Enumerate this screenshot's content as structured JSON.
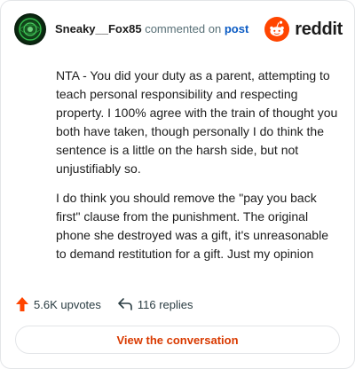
{
  "comment": {
    "username": "Sneaky__Fox85",
    "commented_on": "commented on",
    "post_link": "post",
    "brand": "reddit",
    "paragraphs": [
      "NTA - You did your duty as a parent, attempting to teach personal responsibility and respecting property. I 100% agree with the train of thought you both have taken, though personally I do think the sentence is a little on the harsh side, but not unjustifiably so.",
      "I do think you should remove the \"pay you back first\" clause from the punishment. The original phone she destroyed was a gift, it's unreasonable to demand restitution for a gift. Just my opinion"
    ]
  },
  "actions": {
    "upvotes": "5.6K upvotes",
    "replies": "116 replies"
  },
  "cta": {
    "label": "View the conversation"
  },
  "colors": {
    "accent": "#d93a00",
    "upvote": "#ff4500",
    "link": "#0a5bc4",
    "reddit_orange": "#ff4500"
  },
  "icons": {
    "avatar": "avatar-image",
    "brand_logo": "reddit-snoo-icon",
    "upvote": "upvote-arrow-icon",
    "reply": "reply-arrow-icon"
  }
}
